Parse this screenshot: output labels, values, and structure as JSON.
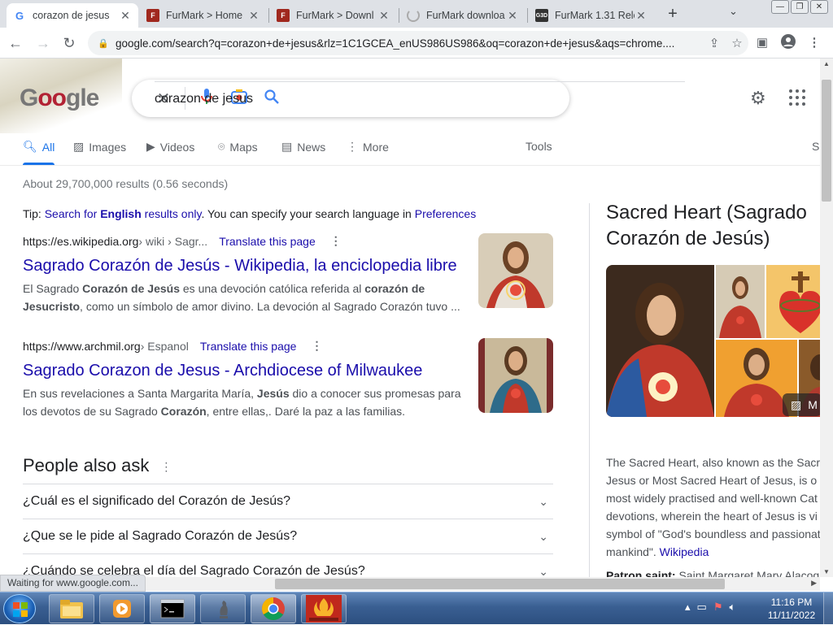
{
  "browser": {
    "tabs": [
      {
        "title": "corazon de jesus",
        "favicon": "google-icon",
        "active": true
      },
      {
        "title": "FurMark > Home",
        "favicon": "furmark-icon",
        "active": false
      },
      {
        "title": "FurMark > Downl",
        "favicon": "furmark-icon",
        "active": false
      },
      {
        "title": "FurMark downloa",
        "favicon": "loading-icon",
        "active": false
      },
      {
        "title": "FurMark 1.31 Rele",
        "favicon": "g3d-icon",
        "active": false
      }
    ],
    "url": "google.com/search?q=corazon+de+jesus&rlz=1C1GCEA_enUS986US986&oq=corazon+de+jesus&aqs=chrome...."
  },
  "google": {
    "query": "corazon de jesus",
    "tabs": [
      "All",
      "Images",
      "Videos",
      "Maps",
      "News",
      "More"
    ],
    "tools": "Tools",
    "safe": "S",
    "stats": "About 29,700,000 results (0.56 seconds)",
    "tip": {
      "prefix": "Tip: ",
      "link1": "Search for ",
      "bold": "English",
      "link1b": " results only",
      "middle": ". You can specify your search language in ",
      "link2": "Preferences"
    },
    "results": [
      {
        "domain": "https://es.wikipedia.org",
        "path": " › wiki › Sagr...",
        "translate": "Translate this page",
        "title": "Sagrado Corazón de Jesús - Wikipedia, la enciclopedia libre",
        "snippet_parts": [
          "El Sagrado ",
          "Corazón de Jesús",
          " es una devoción católica referida al ",
          "corazón de",
          "Jesucristo",
          ", como un símbolo de amor divino. La devoción al Sagrado Corazón tuvo ..."
        ]
      },
      {
        "domain": "https://www.archmil.org",
        "path": " › Espanol",
        "translate": "Translate this page",
        "title": "Sagrado Corazon de Jesus - Archdiocese of Milwaukee",
        "snippet_parts": [
          "En sus revelaciones a Santa Margarita María, ",
          "Jesús",
          " dio a conocer sus promesas para",
          "los devotos de su Sagrado ",
          "Corazón",
          ", entre ellas,. Daré la paz a las familias."
        ]
      }
    ],
    "people_also_ask": {
      "title": "People also ask",
      "questions": [
        "¿Cuál es el significado del Corazón de Jesús?",
        "¿Que se le pide al Sagrado Corazón de Jesús?",
        "¿Cuándo se celebra el día del Sagrado Corazón de Jesús?"
      ]
    },
    "knowledge_panel": {
      "title": "Sacred Heart (Sagrado Corazón de Jesús)",
      "more": "M",
      "description_lines": [
        "The Sacred Heart, also known as the Sacr",
        "Jesus or Most Sacred Heart of Jesus, is o",
        "most widely practised and well-known Cat",
        "devotions, wherein the heart of Jesus is vi",
        "symbol of \"God's boundless and passionat",
        "mankind\". "
      ],
      "source": "Wikipedia",
      "fact_label": "Patron saint:",
      "fact_value": " Saint Margaret Mary Alacoq"
    }
  },
  "status_text": "Waiting for www.google.com...",
  "taskbar": {
    "time": "11:16 PM",
    "date": "11/11/2022",
    "apps": [
      "explorer-icon",
      "media-player-icon",
      "cmd-icon",
      "chess-icon",
      "chrome-icon",
      "furmark-icon"
    ]
  },
  "colors": {
    "link": "#1a0dab",
    "accent": "#1a73e8",
    "tabbar": "#dee1e6"
  }
}
